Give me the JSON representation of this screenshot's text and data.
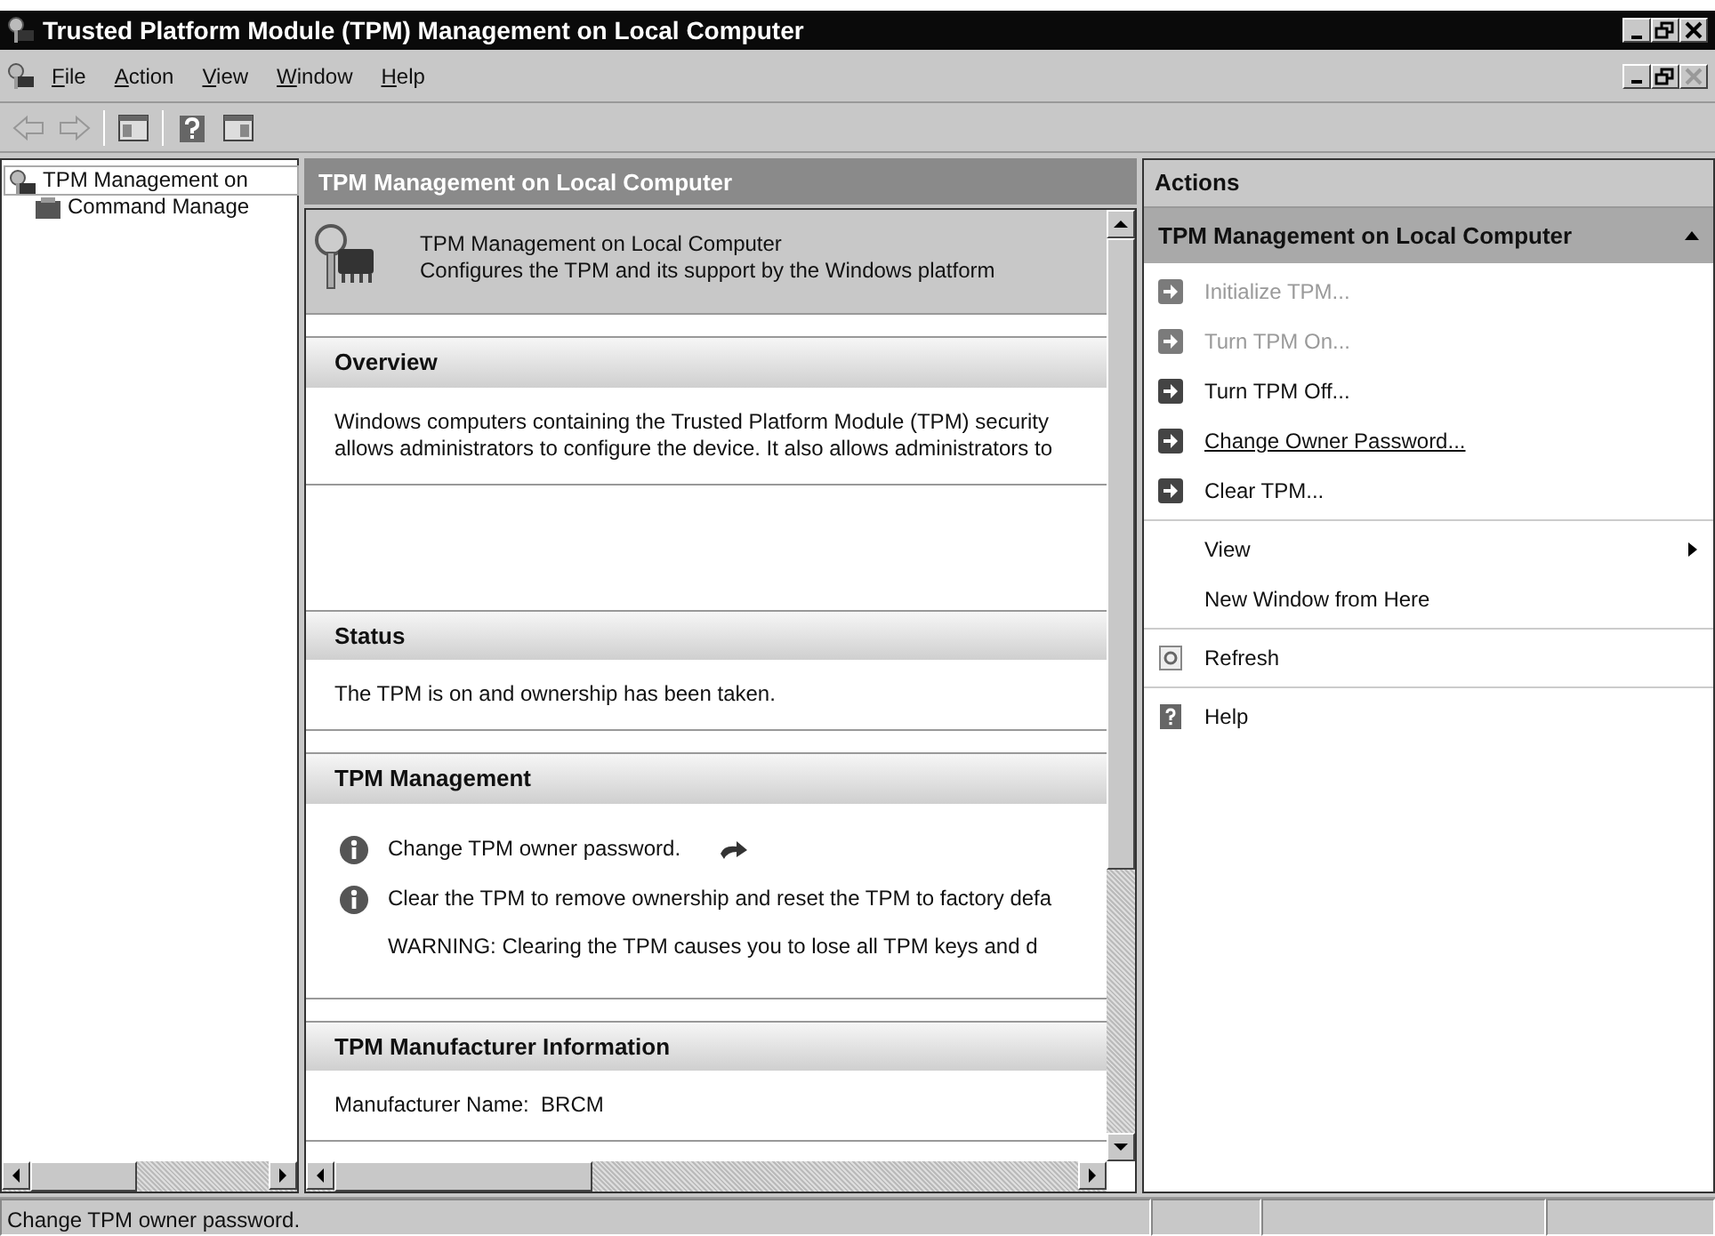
{
  "window": {
    "title": "Trusted Platform Module (TPM) Management on Local Computer"
  },
  "menu": [
    {
      "key": "F",
      "rest": "ile"
    },
    {
      "key": "A",
      "rest": "ction"
    },
    {
      "key": "V",
      "rest": "iew"
    },
    {
      "key": "W",
      "rest": "indow"
    },
    {
      "key": "H",
      "rest": "elp"
    }
  ],
  "toolbar": [
    {
      "kind": "back",
      "disabled": true
    },
    {
      "kind": "forward",
      "disabled": true
    },
    {
      "kind": "show-tree",
      "disabled": false
    },
    {
      "kind": "help",
      "disabled": false
    },
    {
      "kind": "show-actions",
      "disabled": false
    }
  ],
  "tree": [
    {
      "label": "TPM Management on",
      "selected": true,
      "children": [
        {
          "label": "Command Manage",
          "selected": false
        }
      ]
    }
  ],
  "main": {
    "title": "TPM Management on Local Computer",
    "banner": {
      "title": "TPM Management on Local Computer",
      "subtitle": "Configures the TPM and its support by the Windows platform"
    },
    "sections": [
      {
        "title": "Overview",
        "lines": [
          "Windows computers containing the Trusted Platform Module (TPM) security",
          "allows administrators to configure the device. It also allows administrators to"
        ]
      },
      {
        "title": "Status",
        "lines": [
          "The TPM is on and ownership has been taken."
        ]
      },
      {
        "title": "TPM Management",
        "items": [
          {
            "kind": "info",
            "text": "Change TPM owner password.",
            "has_link": true
          },
          {
            "kind": "info",
            "text": "Clear the TPM to remove ownership and reset the TPM to factory defa",
            "has_link": false
          },
          {
            "kind": "note",
            "text": "WARNING: Clearing the TPM causes you to lose all TPM keys and d",
            "has_link": false
          }
        ]
      },
      {
        "title": "TPM Manufacturer Information",
        "lines": [
          "Manufacturer Name:  BRCM"
        ]
      }
    ]
  },
  "actions": {
    "title": "Actions",
    "group_title": "TPM Management on Local Computer",
    "expanded": true,
    "groups": [
      [
        {
          "kind": "arrow",
          "label": "Initialize TPM...",
          "disabled": true,
          "hovered": false
        },
        {
          "kind": "arrow",
          "label": "Turn TPM On...",
          "disabled": true,
          "hovered": false
        },
        {
          "kind": "arrow",
          "label": "Turn TPM Off...",
          "disabled": false,
          "hovered": false
        },
        {
          "kind": "arrow",
          "label": "Change Owner Password...",
          "disabled": false,
          "hovered": true
        },
        {
          "kind": "arrow",
          "label": "Clear TPM...",
          "disabled": false,
          "hovered": false
        }
      ],
      [
        {
          "kind": "submenu",
          "label": "View",
          "disabled": false,
          "hovered": false
        },
        {
          "kind": "plain",
          "label": "New Window from Here",
          "disabled": false,
          "hovered": false
        }
      ],
      [
        {
          "kind": "refresh",
          "label": "Refresh",
          "disabled": false,
          "hovered": false
        }
      ],
      [
        {
          "kind": "help",
          "label": "Help",
          "disabled": false,
          "hovered": false
        }
      ]
    ]
  },
  "status_bar": {
    "text": "Change TPM owner password."
  }
}
